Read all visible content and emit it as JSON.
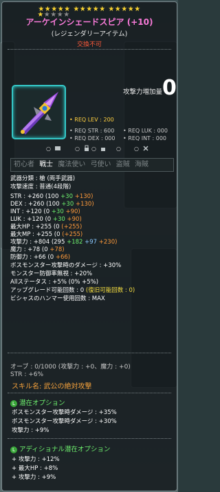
{
  "header": {
    "stars_row1": {
      "on": 15,
      "off": 0
    },
    "stars_row2": {
      "on": 1,
      "off": 4
    },
    "title": "アーケインシェードスピア (+10)",
    "grade": "(レジェンダリーアイテム)",
    "trade": "交換不可"
  },
  "requirements": {
    "lev": "• REQ LEV : 200",
    "str": "• REQ STR : 600",
    "dex": "• REQ DEX : 000",
    "luk": "• REQ LUK : 000",
    "int": "• REQ INT : 000"
  },
  "attack_increase": {
    "label": "攻撃力増加量",
    "value": "0"
  },
  "flag_icons": [
    "○",
    "○",
    "○",
    "○",
    "○"
  ],
  "jobs": {
    "beginner": "初心者",
    "warrior": "戦士",
    "mage": "魔法使い",
    "archer": "弓使い",
    "thief": "盗賊",
    "pirate": "海賊"
  },
  "stats": {
    "weapon_type": "武器分類 : 槍 (両手武器)",
    "attack_speed": "攻撃速度 : 普通(4段階)",
    "str": {
      "label": "STR : +260",
      "base": "(100 ",
      "a": "+30",
      "b": " +130)"
    },
    "dex": {
      "label": "DEX : +260",
      "base": "(100 ",
      "a": "+30",
      "b": " +130)"
    },
    "int": {
      "label": "INT : +120",
      "base": "(0 ",
      "a": "+30",
      "b": " +90)"
    },
    "luk": {
      "label": "LUK : +120",
      "base": "(0 ",
      "a": "+30",
      "b": " +90)"
    },
    "maxhp": {
      "label": "最大HP : +255",
      "base": "(0 ",
      "b": "(+255)"
    },
    "maxmp": {
      "label": "最大MP : +255",
      "base": "(0 ",
      "b": "(+255)"
    },
    "attack": {
      "label": "攻撃力 : +804",
      "base": "(295 ",
      "a": "+182",
      "c": " +97",
      "b": " +230)"
    },
    "magic": {
      "label": "魔力 : +78",
      "base": "(0 ",
      "b": "+78)"
    },
    "defense": {
      "label": "防御力 : +66",
      "base": "(0 ",
      "b": "+66)"
    },
    "boss_damage": "ボスモンスター攻撃時のダメージ : +30%",
    "ignore_def": "モンスター防御率無視 : +20%",
    "all_stat": "Allステータス : +5%",
    "all_stat_detail": "(0% +5%)",
    "upgrade": "アップグレード可能回数 : 0",
    "upgrade_detail": "(復旧可能回数 : 0)",
    "hammer": "ビシャスのハンマー使用回数 : MAX"
  },
  "orb": "オーブ : 0/1000 (攻撃力 : +0、魔力 : +0)",
  "orb_str": "STR : +6%",
  "skill": "スキル名: 武公の絶対攻撃",
  "potential": {
    "header": "潜在オプション",
    "lines": [
      "ボスモンスター攻撃時ダメージ : +35%",
      "ボスモンスター攻撃時ダメージ : +30%",
      "攻撃力 : +9%"
    ]
  },
  "additional": {
    "header": "アディショナル潜在オプション",
    "lines": [
      "+ 攻撃力 : +12%",
      "+ 最大HP : +8%",
      "+ 攻撃力 : +9%"
    ]
  },
  "colors": {
    "title": "#f87ad8",
    "trade": "#ff5a3a",
    "green": "#6ef06e",
    "orange": "#ff9a3a",
    "skill": "#f5a23c"
  },
  "icons": [
    "spear-item-icon",
    "star-icon",
    "potential-icon"
  ]
}
